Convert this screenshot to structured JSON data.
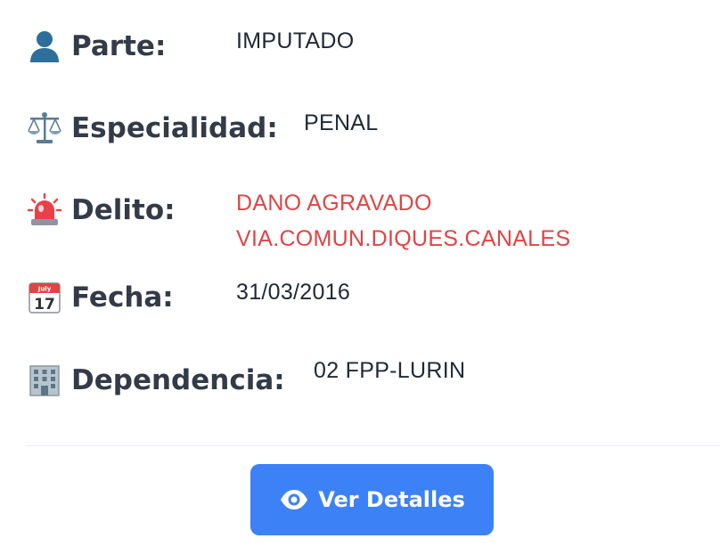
{
  "fields": [
    {
      "label": "Parte:",
      "value": "IMPUTADO",
      "icon": "person-icon"
    },
    {
      "label": "Especialidad:",
      "value": "PENAL",
      "icon": "scales-icon"
    },
    {
      "label": "Delito:",
      "value_lines": [
        "DANO AGRAVADO",
        "VIA.COMUN.DIQUES.CANALES"
      ],
      "icon": "siren-icon",
      "value_color": "#e04444"
    },
    {
      "label": "Fecha:",
      "value": "31/03/2016",
      "icon": "calendar-icon",
      "calendar_month": "July",
      "calendar_day": "17"
    },
    {
      "label": "Dependencia:",
      "value": "02 FPP-LURIN",
      "icon": "office-building-icon"
    }
  ],
  "button": {
    "label": "Ver Detalles",
    "icon": "eye-icon",
    "color": "#3c82f6"
  }
}
